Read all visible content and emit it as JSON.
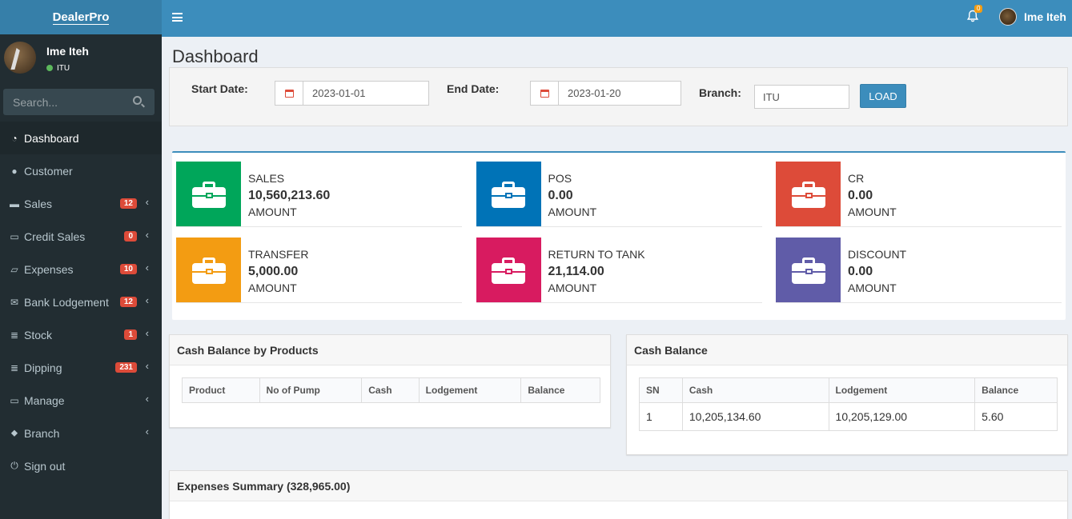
{
  "app": {
    "brand": "DealerPro"
  },
  "user": {
    "name": "Ime Iteh",
    "status": "ITU"
  },
  "search": {
    "placeholder": "Search..."
  },
  "sidebar": {
    "items": [
      {
        "label": "Dashboard",
        "icon": "dashboard-icon",
        "glyph": "◔",
        "badge": "",
        "chevron": ""
      },
      {
        "label": "Customer",
        "icon": "user-icon",
        "glyph": "●",
        "badge": "",
        "chevron": ""
      },
      {
        "label": "Sales",
        "icon": "folder-icon",
        "glyph": "▬",
        "badge": "12",
        "chevron": "‹"
      },
      {
        "label": "Credit Sales",
        "icon": "credit-card-icon",
        "glyph": "▭",
        "badge": "0",
        "chevron": "‹"
      },
      {
        "label": "Expenses",
        "icon": "book-icon",
        "glyph": "▱",
        "badge": "10",
        "chevron": "‹"
      },
      {
        "label": "Bank Lodgement",
        "icon": "envelope-icon",
        "glyph": "✉",
        "badge": "12",
        "chevron": "‹"
      },
      {
        "label": "Stock",
        "icon": "database-icon",
        "glyph": "≣",
        "badge": "1",
        "chevron": "‹"
      },
      {
        "label": "Dipping",
        "icon": "database-icon",
        "glyph": "≣",
        "badge": "231",
        "chevron": "‹"
      },
      {
        "label": "Manage",
        "icon": "laptop-icon",
        "glyph": "▭",
        "badge": "",
        "chevron": "‹"
      },
      {
        "label": "Branch",
        "icon": "map-marker-icon",
        "glyph": "⬥",
        "badge": "",
        "chevron": "‹"
      },
      {
        "label": "Sign out",
        "icon": "power-icon",
        "glyph": "⏻",
        "badge": "",
        "chevron": ""
      }
    ]
  },
  "header": {
    "notification_count": "0",
    "user_name": "Ime Iteh"
  },
  "page": {
    "title": "Dashboard"
  },
  "filters": {
    "start_label": "Start Date:",
    "start_value": "2023-01-01",
    "end_label": "End Date:",
    "end_value": "2023-01-20",
    "branch_label": "Branch:",
    "branch_value": "ITU",
    "load_label": "LOAD"
  },
  "stats": [
    {
      "label": "SALES",
      "value": "10,560,213.60",
      "unit": "AMOUNT",
      "color": "#00a65a"
    },
    {
      "label": "POS",
      "value": "0.00",
      "unit": "AMOUNT",
      "color": "#0073b7"
    },
    {
      "label": "CR",
      "value": "0.00",
      "unit": "AMOUNT",
      "color": "#dd4b39"
    },
    {
      "label": "TRANSFER",
      "value": "5,000.00",
      "unit": "AMOUNT",
      "color": "#f39c12"
    },
    {
      "label": "RETURN TO TANK",
      "value": "21,114.00",
      "unit": "AMOUNT",
      "color": "#d81b60"
    },
    {
      "label": "DISCOUNT",
      "value": "0.00",
      "unit": "AMOUNT",
      "color": "#605ca8"
    }
  ],
  "cash_by_products": {
    "title": "Cash Balance by Products",
    "columns": [
      "Product",
      "No of Pump",
      "Cash",
      "Lodgement",
      "Balance"
    ]
  },
  "cash_balance": {
    "title": "Cash Balance",
    "columns": [
      "SN",
      "Cash",
      "Lodgement",
      "Balance"
    ],
    "rows": [
      [
        "1",
        "10,205,134.60",
        "10,205,129.00",
        "5.60"
      ]
    ]
  },
  "expenses_summary": {
    "title": "Expenses Summary (328,965.00)"
  }
}
